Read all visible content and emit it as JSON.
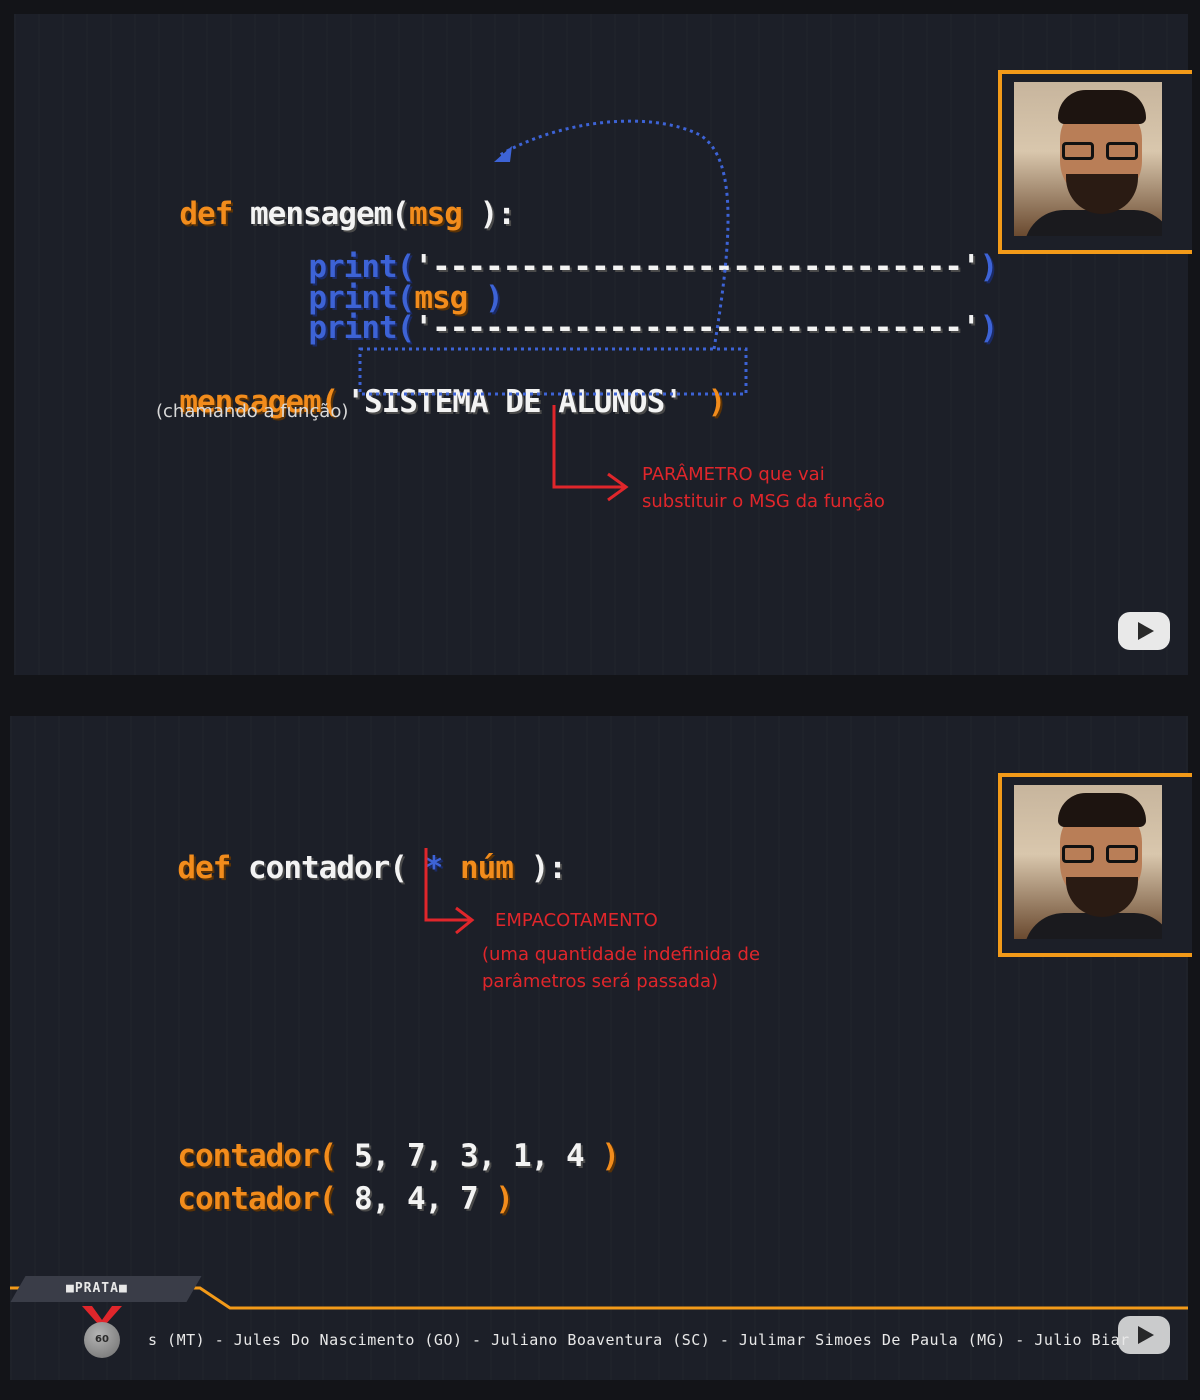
{
  "slide1": {
    "def_line": {
      "kw": "def",
      "name": " mensagem(",
      "param": "msg",
      "close": " ):"
    },
    "print_lines": [
      {
        "fn": "print(",
        "arg": "'------------------------------'",
        "close": ")"
      },
      {
        "fn": "print(",
        "arg": "msg",
        "close": " )"
      },
      {
        "fn": "print(",
        "arg": "'------------------------------'",
        "close": ")"
      }
    ],
    "call": {
      "fn": "mensagem(",
      "arg": "'SISTEMA DE ALUNOS'",
      "close": " )"
    },
    "call_note": "(chamando a função)",
    "param_note_1": "PARÂMETRO que vai",
    "param_note_2": "substituir o MSG da função"
  },
  "slide2": {
    "def_line": {
      "kw": "def",
      "name": " contador(",
      "star": " *",
      "param": " núm",
      "close": " ):"
    },
    "note_title": "EMPACOTAMENTO",
    "note_1": "(uma quantidade indefinida de",
    "note_2": "parâmetros será passada)",
    "calls": [
      {
        "fn": "contador(",
        "args": " 5, 7, 3, 1, 4",
        "close": " )"
      },
      {
        "fn": "contador(",
        "args": " 8, 4, 7",
        "close": " )"
      }
    ]
  },
  "ticker": {
    "badge": "■PRATA■",
    "medal": "60",
    "text": "s (MT) - Jules Do Nascimento (GO) - Juliano Boaventura (SC) - Julimar Simoes De Paula (MG) - Julio Biar"
  },
  "colors": {
    "keyword": "#f28c1c",
    "name": "#f3f3f3",
    "builtin": "#3d63d6",
    "annotation": "#e0262b",
    "cam_border": "#f29a19"
  }
}
